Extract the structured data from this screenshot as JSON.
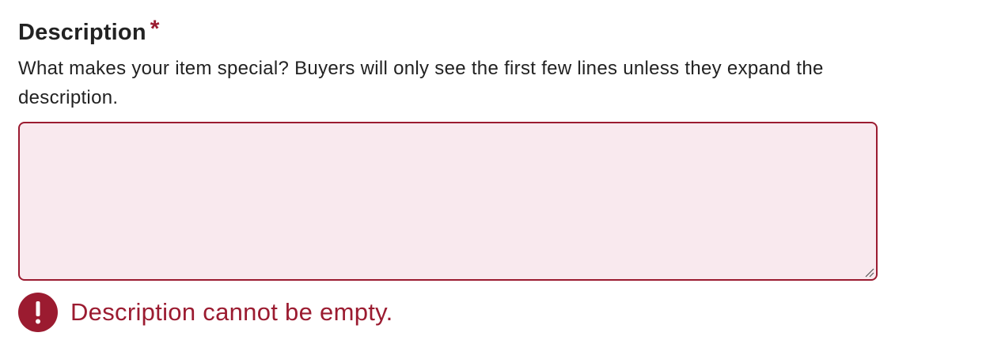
{
  "field": {
    "label": "Description",
    "required_marker": "*",
    "help_text": "What makes your item special? Buyers will only see the first few lines unless they expand the description.",
    "textarea_value": "",
    "error_message": "Description cannot be empty."
  },
  "icons": {
    "error": "exclamation-circle-icon",
    "resize": "resize-handle-icon"
  },
  "colors": {
    "error": "#9b1b30",
    "textarea_error_bg": "#f9e9ee",
    "text": "#222222"
  }
}
